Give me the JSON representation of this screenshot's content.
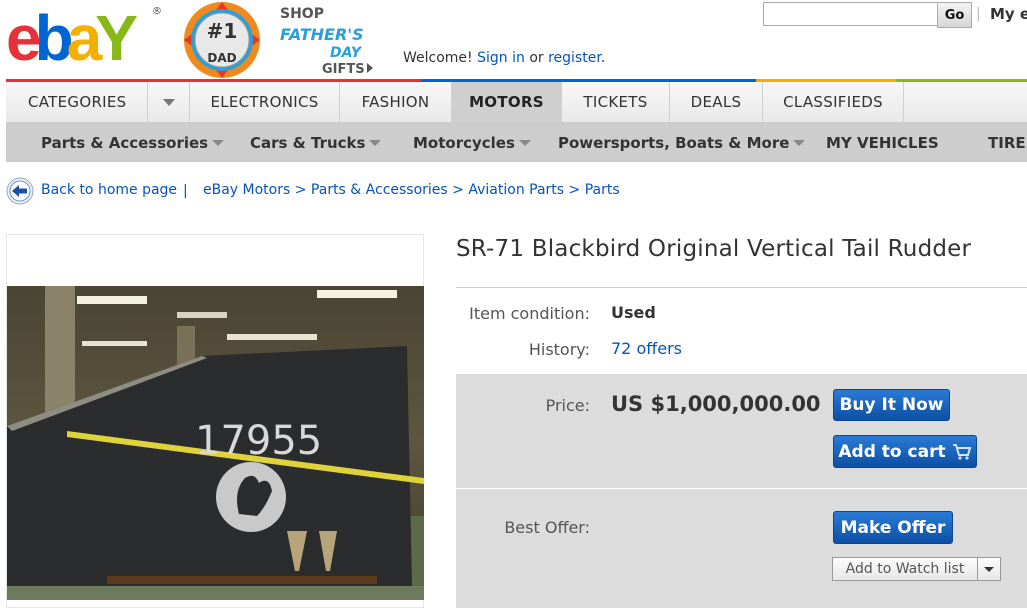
{
  "header": {
    "logo_text": "ebay",
    "promo": {
      "shop": "SHOP",
      "fathers": "FATHER'S",
      "day": "DAY",
      "gifts": "GIFTS",
      "badge_num": "#1",
      "badge_dad": "DAD"
    },
    "welcome_prefix": "Welcome!",
    "sign_in": "Sign in",
    "or": "or",
    "register": "register",
    "period": ".",
    "search_value": "",
    "go_label": "Go",
    "separator": "|",
    "my_ebay": "My e"
  },
  "nav": {
    "tabs": [
      {
        "label": "CATEGORIES"
      },
      {
        "label": "ELECTRONICS"
      },
      {
        "label": "FASHION"
      },
      {
        "label": "MOTORS",
        "active": true
      },
      {
        "label": "TICKETS"
      },
      {
        "label": "DEALS"
      },
      {
        "label": "CLASSIFIEDS"
      }
    ],
    "sub": [
      {
        "label": "Parts & Accessories"
      },
      {
        "label": "Cars & Trucks"
      },
      {
        "label": "Motorcycles"
      },
      {
        "label": "Powersports, Boats & More"
      },
      {
        "label": "MY VEHICLES"
      },
      {
        "label": "TIRE"
      }
    ]
  },
  "breadcrumb": {
    "back": "Back to home page",
    "separator": "|",
    "items": [
      "eBay Motors",
      "Parts & Accessories",
      "Aviation Parts",
      "Parts"
    ],
    "arrow": ">"
  },
  "item": {
    "title": "SR-71 Blackbird Original Vertical Tail Rudder",
    "photo_number": "17955",
    "condition_label": "Item condition:",
    "condition_value": "Used",
    "history_label": "History:",
    "history_value": "72 offers",
    "price_label": "Price:",
    "price_value": "US $1,000,000.00",
    "buy_now": "Buy It Now",
    "add_to_cart": "Add to cart",
    "best_offer_label": "Best Offer:",
    "make_offer": "Make Offer",
    "watch": "Add to Watch list"
  },
  "colors": {
    "link": "#0654ba",
    "button_blue": "#0d4fa5",
    "price_bg": "#dcdcdc",
    "colorbar": [
      "#e53238",
      "#0064d2",
      "#f5af02",
      "#86b817"
    ]
  },
  "icons": [
    "back-arrow-icon",
    "cart-icon",
    "chevron-down-icon"
  ]
}
